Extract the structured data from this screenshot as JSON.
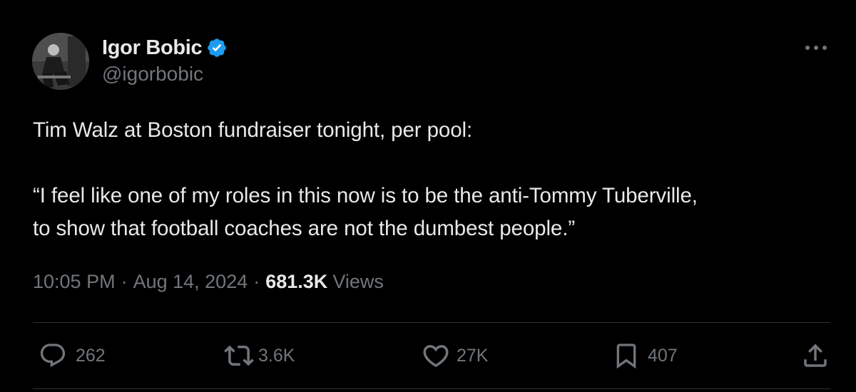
{
  "author": {
    "display_name": "Igor Bobic",
    "handle": "@igorbobic",
    "verified": true
  },
  "tweet": {
    "line1": "Tim Walz at Boston fundraiser tonight, per pool:",
    "quote_line1": "“I feel like one of my roles in this now is to be the anti-Tommy Tuberville,",
    "quote_line2": "to show that football coaches are not the dumbest people.”"
  },
  "meta": {
    "time": "10:05 PM",
    "date": "Aug 14, 2024",
    "views_count": "681.3K",
    "views_label": "Views"
  },
  "actions": {
    "replies": "262",
    "reposts": "3.6K",
    "likes": "27K",
    "bookmarks": "407"
  },
  "colors": {
    "background": "#000000",
    "text": "#e7e9ea",
    "secondary": "#71767b",
    "verified": "#1d9bf0",
    "divider": "#2f3336"
  },
  "icons": {
    "verified": "verified-badge-icon",
    "more": "more-horizontal-icon",
    "reply": "reply-bubble-icon",
    "repost": "repost-arrows-icon",
    "like": "heart-icon",
    "bookmark": "bookmark-icon",
    "share": "share-upload-icon"
  }
}
